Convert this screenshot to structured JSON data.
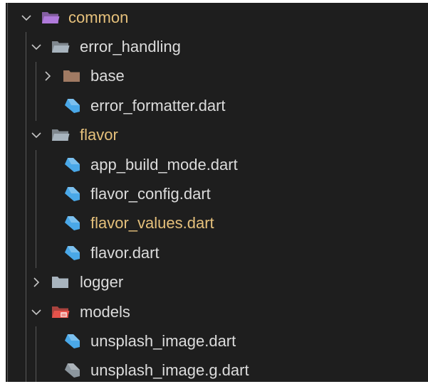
{
  "explorer": {
    "items": [
      {
        "label": "common",
        "kind": "folder-open",
        "depth": 0,
        "expanded": true,
        "icon": "folder-open-icon",
        "icon_color": "#b07adb",
        "label_color": "#e5c07b"
      },
      {
        "label": "error_handling",
        "kind": "folder-open",
        "depth": 1,
        "expanded": true,
        "icon": "folder-open-icon",
        "icon_color": "#a8b4be",
        "label_color": "#dcdcdc"
      },
      {
        "label": "base",
        "kind": "folder",
        "depth": 2,
        "expanded": false,
        "icon": "folder-icon",
        "icon_color": "#a07a63",
        "label_color": "#dcdcdc"
      },
      {
        "label": "error_formatter.dart",
        "kind": "file",
        "depth": 2,
        "icon": "dart-file-icon",
        "icon_color": "#4aa8e8",
        "label_color": "#dcdcdc"
      },
      {
        "label": "flavor",
        "kind": "folder-open",
        "depth": 1,
        "expanded": true,
        "icon": "folder-open-icon",
        "icon_color": "#a8b4be",
        "label_color": "#e5c07b"
      },
      {
        "label": "app_build_mode.dart",
        "kind": "file",
        "depth": 2,
        "icon": "dart-file-icon",
        "icon_color": "#4aa8e8",
        "label_color": "#dcdcdc"
      },
      {
        "label": "flavor_config.dart",
        "kind": "file",
        "depth": 2,
        "icon": "dart-file-icon",
        "icon_color": "#4aa8e8",
        "label_color": "#dcdcdc"
      },
      {
        "label": "flavor_values.dart",
        "kind": "file",
        "depth": 2,
        "icon": "dart-file-icon",
        "icon_color": "#4aa8e8",
        "label_color": "#e5c07b"
      },
      {
        "label": "flavor.dart",
        "kind": "file",
        "depth": 2,
        "icon": "dart-file-icon",
        "icon_color": "#4aa8e8",
        "label_color": "#dcdcdc"
      },
      {
        "label": "logger",
        "kind": "folder",
        "depth": 1,
        "expanded": false,
        "icon": "folder-icon",
        "icon_color": "#a8b4be",
        "label_color": "#dcdcdc"
      },
      {
        "label": "models",
        "kind": "folder-open",
        "depth": 1,
        "expanded": true,
        "icon": "folder-open-icon",
        "icon_color": "#e5534b",
        "label_color": "#dcdcdc"
      },
      {
        "label": "unsplash_image.dart",
        "kind": "file",
        "depth": 2,
        "icon": "dart-file-icon",
        "icon_color": "#4aa8e8",
        "label_color": "#dcdcdc"
      },
      {
        "label": "unsplash_image.g.dart",
        "kind": "file",
        "depth": 2,
        "icon": "dart-file-icon",
        "icon_color": "#8c969e",
        "label_color": "#dcdcdc"
      }
    ]
  },
  "colors": {
    "background": "#1e1e1e",
    "chevron": "#c5c5c5",
    "guide": "#585858"
  }
}
